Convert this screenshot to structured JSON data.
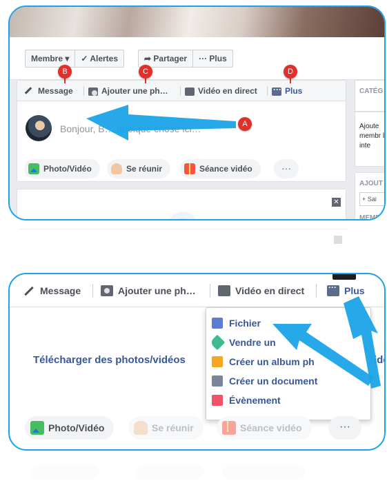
{
  "panel1": {
    "page_buttons": {
      "member": "Membre ▾",
      "alerts": "✓ Alertes",
      "share": "➦ Partager",
      "more": "··· Plus"
    },
    "composer_tabs": {
      "message": "Message",
      "add_photo": "Ajouter une ph…",
      "live_video": "Vidéo en direct",
      "more": "Plus"
    },
    "prompt": "Bonjour, B…  quelque chose ici…",
    "action_chips": {
      "photo_video": "Photo/Vidéo",
      "meet": "Se réunir",
      "watch_party": "Séance vidéo",
      "more": "···"
    },
    "right_column": {
      "category_label": "CATÉG",
      "about_text": "Ajoute membr les inte",
      "add_label": "AJOUT",
      "add_input": "+ Sai",
      "members_label": "MEMB"
    },
    "close_glyph": "✕"
  },
  "badges": {
    "a": "A",
    "b": "B",
    "c": "C",
    "d": "D"
  },
  "panel2": {
    "tabs": {
      "message": "Message",
      "add_photo": "Ajouter une ph…",
      "live_video": "Vidéo en direct",
      "more": "Plus"
    },
    "upload_text": "Télécharger des photos/vidéos",
    "upload_right": "ide",
    "dropdown": [
      {
        "label": "Fichier",
        "icon": "file-icon",
        "color": "#5b7bd5"
      },
      {
        "label": "Vendre un",
        "icon": "tag-icon",
        "color": "#3dbd8d"
      },
      {
        "label": "Créer un album ph",
        "icon": "album-icon",
        "color": "#f5a623"
      },
      {
        "label": "Créer un document",
        "icon": "document-icon",
        "color": "#7a8597"
      },
      {
        "label": "Évènement",
        "icon": "calendar-icon",
        "color": "#f25268"
      }
    ],
    "chips": {
      "photo_video": "Photo/Vidéo",
      "meet": "Se réunir",
      "watch_party": "Séance vidéo",
      "more": "···"
    }
  },
  "colors": {
    "annotation_arrow": "#1aa3e8",
    "badge": "#e0302b",
    "frame": "#1aa3e8"
  }
}
